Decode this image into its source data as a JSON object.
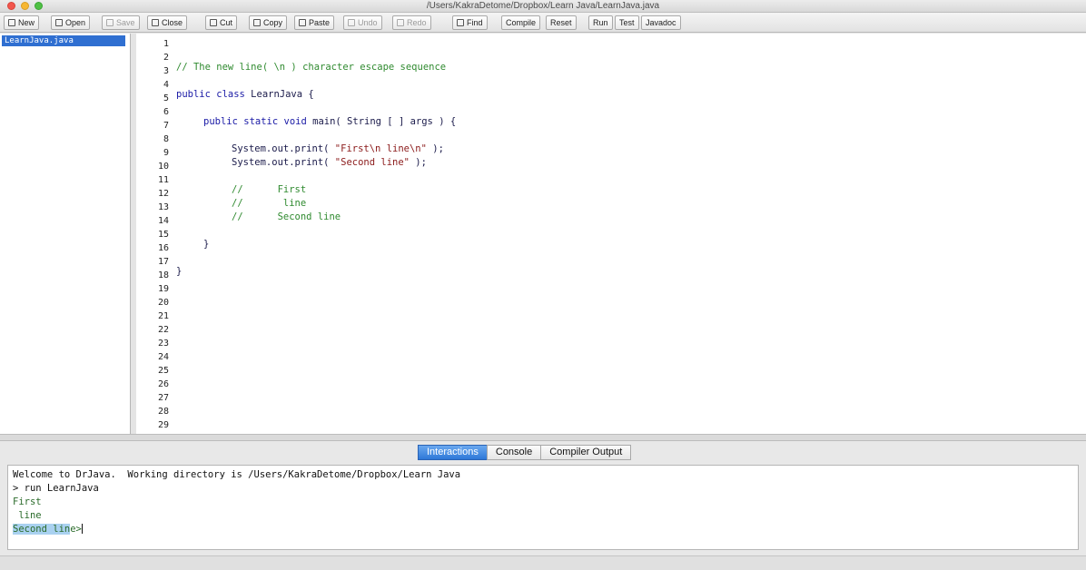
{
  "window": {
    "title": "/Users/KakraDetome/Dropbox/Learn Java/LearnJava.java",
    "traffic_colors": {
      "close": "#f2564d",
      "minimize": "#f7b733",
      "maximize": "#4fc044"
    }
  },
  "toolbar": {
    "new": "New",
    "open": "Open",
    "save": "Save",
    "close": "Close",
    "cut": "Cut",
    "copy": "Copy",
    "paste": "Paste",
    "undo": "Undo",
    "redo": "Redo",
    "find": "Find",
    "compile": "Compile",
    "reset": "Reset",
    "run": "Run",
    "test": "Test",
    "javadoc": "Javadoc"
  },
  "files": {
    "items": [
      {
        "label": "LearnJava.java",
        "selected": true
      }
    ]
  },
  "editor": {
    "line_numbers": [
      "1",
      "2",
      "3",
      "4",
      "5",
      "6",
      "7",
      "8",
      "9",
      "10",
      "11",
      "12",
      "13",
      "14",
      "15",
      "16",
      "17",
      "18",
      "19",
      "20",
      "21",
      "22",
      "23",
      "24",
      "25",
      "26",
      "27",
      "28",
      "29"
    ],
    "lines": {
      "l3": "// The new line( \\n ) character escape sequence",
      "l5_kw": "public class",
      "l5_rest": " LearnJava {",
      "l7_kw": "public static void",
      "l7_rest": " main( String [ ] args ) {",
      "l9_pre": "System.out.print( ",
      "l9_str": "\"First\\n line\\n\"",
      "l9_post": " );",
      "l10_pre": "System.out.print( ",
      "l10_str": "\"Second line\"",
      "l10_post": " );",
      "l12": "//      First",
      "l13": "//       line",
      "l14": "//      Second line",
      "l16": "}",
      "l18": "}"
    }
  },
  "bottom_tabs": {
    "interactions": "Interactions",
    "console": "Console",
    "compiler_output": "Compiler Output",
    "active": "Interactions",
    "active_color": "#2e78d8"
  },
  "interactions": {
    "welcome": "Welcome to DrJava.  Working directory is /Users/KakraDetome/Dropbox/Learn Java",
    "command": "> run LearnJava",
    "out1": "First",
    "out2": " line",
    "out3_selected": "Second lin",
    "out3_rest": "e",
    "prompt": ">"
  }
}
